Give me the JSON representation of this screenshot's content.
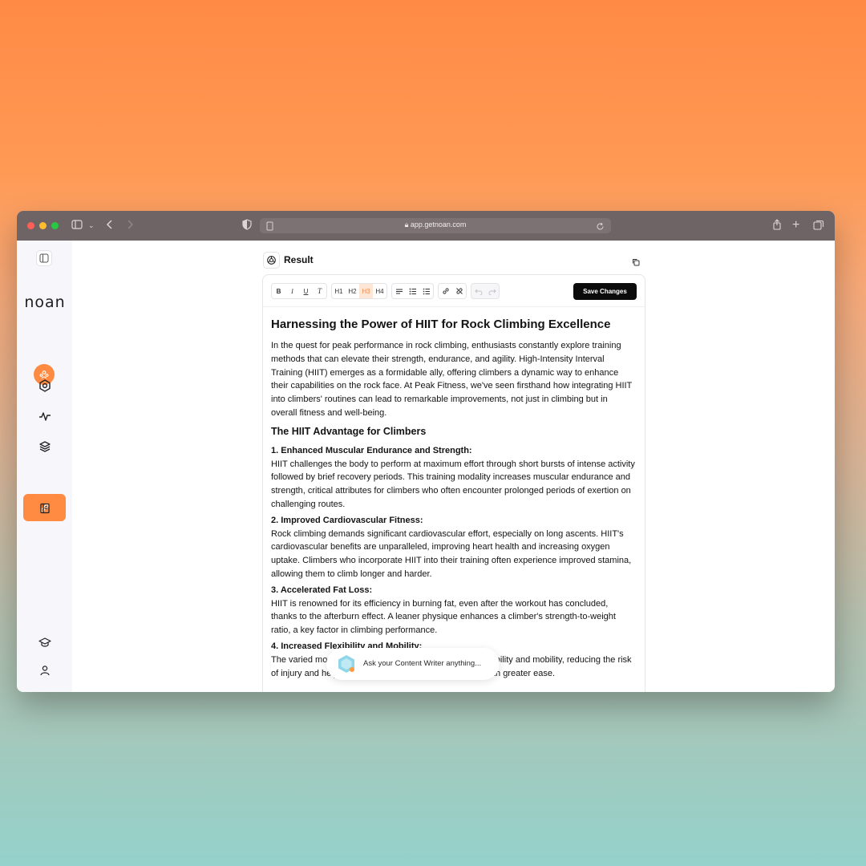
{
  "browser": {
    "url": "app.getnoan.com",
    "colors": {
      "close": "#ff5f57",
      "minimize": "#febc2e",
      "zoom": "#28c840"
    }
  },
  "sidebar": {
    "logo": "noan",
    "items": [
      {
        "name": "settings-hex-icon"
      },
      {
        "name": "activity-icon"
      },
      {
        "name": "layers-icon"
      },
      {
        "name": "pencil-icon",
        "active": true
      },
      {
        "name": "notebook-icon"
      },
      {
        "name": "graduation-cap-icon"
      },
      {
        "name": "user-icon"
      }
    ],
    "accent": "#ff8b43"
  },
  "result": {
    "title": "Result"
  },
  "toolbar": {
    "bold": "B",
    "italic": "I",
    "underline": "U",
    "clear_format": "T",
    "h1": "H1",
    "h2": "H2",
    "h3": "H3",
    "h4": "H4",
    "save_label": "Save Changes"
  },
  "article": {
    "title": "Harnessing the Power of HIIT for Rock Climbing Excellence",
    "intro": "In the quest for peak performance in rock climbing, enthusiasts constantly explore training methods that can elevate their strength, endurance, and agility. High-Intensity Interval Training (HIIT) emerges as a formidable ally, offering climbers a dynamic way to enhance their capabilities on the rock face. At Peak Fitness, we've seen firsthand how integrating HIIT into climbers' routines can lead to remarkable improvements, not just in climbing but in overall fitness and well-being.",
    "subtitle": "The HIIT Advantage for Climbers",
    "sections": [
      {
        "heading": "1. Enhanced Muscular Endurance and Strength:",
        "body": "HIIT challenges the body to perform at maximum effort through short bursts of intense activity followed by brief recovery periods. This training modality increases muscular endurance and strength, critical attributes for climbers who often encounter prolonged periods of exertion on challenging routes."
      },
      {
        "heading": "2. Improved Cardiovascular Fitness:",
        "body": "Rock climbing demands significant cardiovascular effort, especially on long ascents. HIIT's cardiovascular benefits are unparalleled, improving heart health and increasing oxygen uptake. Climbers who incorporate HIIT into their training often experience improved stamina, allowing them to climb longer and harder."
      },
      {
        "heading": "3. Accelerated Fat Loss:",
        "body": "HIIT is renowned for its efficiency in burning fat, even after the workout has concluded, thanks to the afterburn effect. A leaner physique enhances a climber's strength-to-weight ratio, a key factor in climbing performance."
      },
      {
        "heading": "4. Increased Flexibility and Mobility:",
        "body": "The varied movements in HIIT workouts can improve flexibility and mobility, reducing the risk of injury and helping climbers execute complex moves with greater ease."
      }
    ]
  },
  "chat": {
    "placeholder": "Ask your Content Writer anything..."
  }
}
